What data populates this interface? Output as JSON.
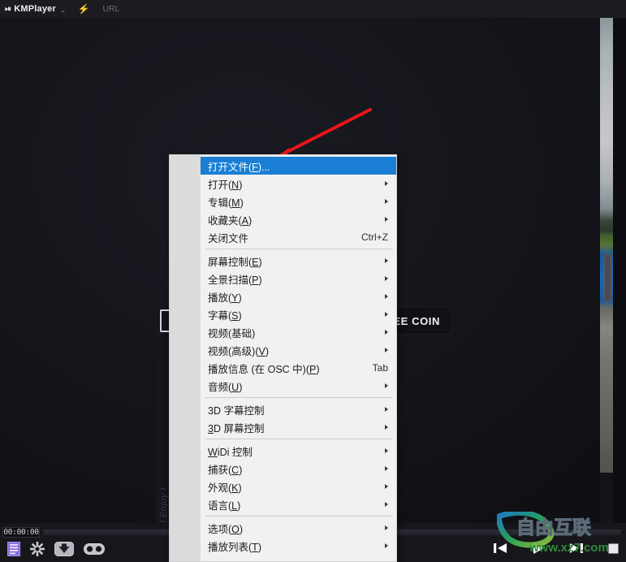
{
  "colors": {
    "accent_selected": "#1a7fd4",
    "menu_bg": "#f1f1f1",
    "menu_gutter": "#dcdcdc",
    "titlebar_bg": "#1b1b20",
    "arrow_red": "#e8161a",
    "playlist_icon": "#8a6ee0"
  },
  "titlebar": {
    "logo_mark": "⏯",
    "app_name": "KMPlayer",
    "caret_icon": "chevron-down-icon",
    "caret_glyph": "⌄",
    "bolt_glyph": "⚡",
    "url_label": "URL"
  },
  "stage": {
    "promo_vertical_text": "e All Enjoy !",
    "free_coin_label": "FREE COIN"
  },
  "context_menu": {
    "sections": [
      {
        "items": [
          {
            "label": "打开文件(F)...",
            "mnemonic": "F",
            "accel": "",
            "submenu": false,
            "selected": true
          },
          {
            "label": "打开(N)",
            "mnemonic": "N",
            "accel": "",
            "submenu": true,
            "selected": false
          },
          {
            "label": "专辑(M)",
            "mnemonic": "M",
            "accel": "",
            "submenu": true,
            "selected": false
          },
          {
            "label": "收藏夹(A)",
            "mnemonic": "A",
            "accel": "",
            "submenu": true,
            "selected": false
          },
          {
            "label": "关闭文件",
            "mnemonic": "",
            "accel": "Ctrl+Z",
            "submenu": false,
            "selected": false
          }
        ]
      },
      {
        "items": [
          {
            "label": "屏幕控制(E)",
            "mnemonic": "E",
            "accel": "",
            "submenu": true,
            "selected": false
          },
          {
            "label": "全景扫描(P)",
            "mnemonic": "P",
            "accel": "",
            "submenu": true,
            "selected": false
          },
          {
            "label": "播放(Y)",
            "mnemonic": "Y",
            "accel": "",
            "submenu": true,
            "selected": false
          },
          {
            "label": "字幕(S)",
            "mnemonic": "S",
            "accel": "",
            "submenu": true,
            "selected": false
          },
          {
            "label": "视频(基础)",
            "mnemonic": "",
            "accel": "",
            "submenu": true,
            "selected": false
          },
          {
            "label": "视频(高级)(V)",
            "mnemonic": "V",
            "accel": "",
            "submenu": true,
            "selected": false
          },
          {
            "label": "播放信息 (在 OSC 中)(P)",
            "mnemonic": "P",
            "accel": "Tab",
            "submenu": false,
            "selected": false
          },
          {
            "label": "音频(U)",
            "mnemonic": "U",
            "accel": "",
            "submenu": true,
            "selected": false
          }
        ]
      },
      {
        "items": [
          {
            "label": "3D 字幕控制",
            "mnemonic": "",
            "accel": "",
            "submenu": true,
            "selected": false
          },
          {
            "label": "3D 屏幕控制",
            "mnemonic": "3",
            "accel": "",
            "submenu": true,
            "selected": false
          }
        ]
      },
      {
        "items": [
          {
            "label": "WiDi 控制",
            "mnemonic": "W",
            "accel": "",
            "submenu": true,
            "selected": false
          },
          {
            "label": "捕获(C)",
            "mnemonic": "C",
            "accel": "",
            "submenu": true,
            "selected": false
          },
          {
            "label": "外观(K)",
            "mnemonic": "K",
            "accel": "",
            "submenu": true,
            "selected": false
          },
          {
            "label": "语言(L)",
            "mnemonic": "L",
            "accel": "",
            "submenu": true,
            "selected": false
          }
        ]
      },
      {
        "items": [
          {
            "label": "选项(O)",
            "mnemonic": "O",
            "accel": "",
            "submenu": true,
            "selected": false
          },
          {
            "label": "播放列表(T)",
            "mnemonic": "T",
            "accel": "",
            "submenu": true,
            "selected": false
          }
        ]
      }
    ]
  },
  "bottombar": {
    "timecode": "00:00:00",
    "progress_percent": 0,
    "left_buttons": [
      {
        "name": "playlist-icon",
        "title": "播放列表"
      },
      {
        "name": "gear-icon",
        "title": "选项"
      },
      {
        "name": "download-icon",
        "title": "下载"
      },
      {
        "name": "vr-goggles-icon",
        "title": "VR"
      }
    ],
    "right_buttons": [
      {
        "name": "previous-icon",
        "title": "上一个"
      },
      {
        "name": "play-icon",
        "title": "播放"
      },
      {
        "name": "next-icon",
        "title": "下一个"
      },
      {
        "name": "stop-icon",
        "title": "停止"
      }
    ]
  },
  "watermark": {
    "main_text": "自由互联",
    "url_text": "www.xz7.com"
  }
}
